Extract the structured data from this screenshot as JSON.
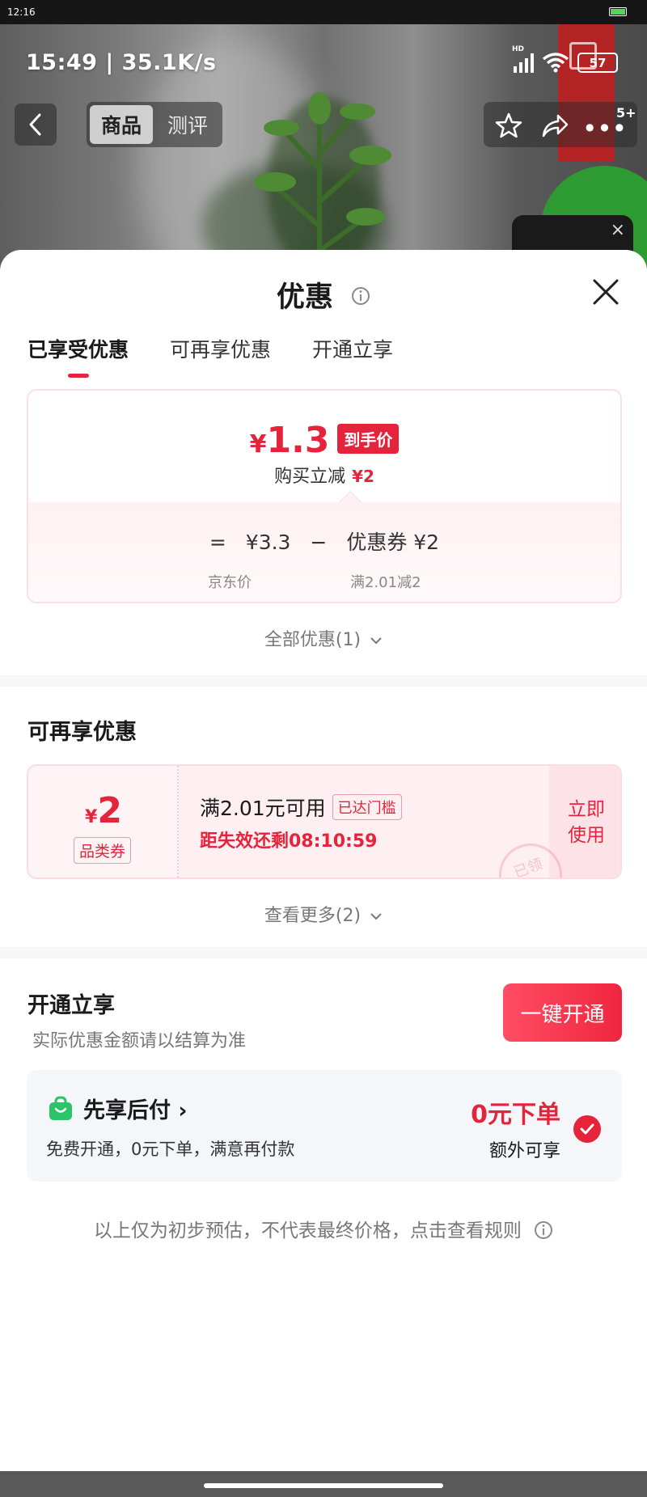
{
  "system": {
    "time": "12:16"
  },
  "status_overlay": {
    "time_speed": "15:49 | 35.1K/s",
    "battery": "57",
    "signal_label": "HD"
  },
  "product_nav": {
    "tabs": [
      {
        "label": "商品"
      },
      {
        "label": "测评"
      }
    ],
    "cart_badge": "5+"
  },
  "sheet": {
    "title": "优惠",
    "tabs": [
      {
        "label": "已享受优惠"
      },
      {
        "label": "可再享优惠"
      },
      {
        "label": "开通立享"
      }
    ],
    "price_card": {
      "currency": "¥",
      "final_price": "1.3",
      "final_tag": "到手价",
      "saving_label": "购买立减",
      "saving_amount": "¥2",
      "formula_equals": "=",
      "base_price": "¥3.3",
      "minus": "−",
      "coupon_part": "优惠券 ¥2",
      "base_label": "京东价",
      "coupon_condition": "满2.01减2"
    },
    "all_offers": "全部优惠(1)",
    "more_offers": {
      "title": "可再享优惠",
      "coupon": {
        "currency": "¥",
        "amount": "2",
        "category": "品类券",
        "condition": "满2.01元可用",
        "threshold_tag": "已达门槛",
        "countdown": "距失效还剩08:10:59",
        "use_label_1": "立即",
        "use_label_2": "使用",
        "stamp": "已领"
      },
      "see_more": "查看更多(2)"
    },
    "open_offers": {
      "title": "开通立享",
      "note": "实际优惠金额请以结算为准",
      "button": "一键开通",
      "paylater": {
        "name": "先享后付 ›",
        "desc": "免费开通，0元下单，满意再付款",
        "headline": "0元下单",
        "sub": "额外可享"
      }
    },
    "disclaimer": "以上仅为初步预估，不代表最终价格，点击查看规则"
  },
  "colors": {
    "accent": "#e5243b",
    "check_green": "#2cc46b"
  }
}
